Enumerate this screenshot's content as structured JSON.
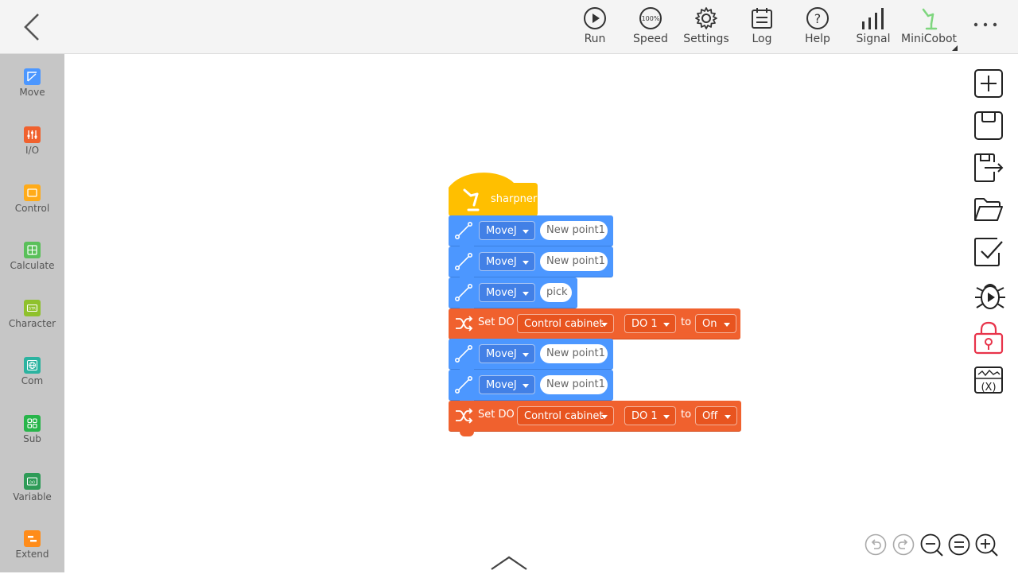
{
  "toolbar": {
    "run": "Run",
    "speed": "Speed",
    "speed_value": "100%",
    "settings": "Settings",
    "log": "Log",
    "help": "Help",
    "signal": "Signal",
    "robot": "MiniCobot"
  },
  "sidebar": {
    "items": [
      {
        "label": "Move",
        "color": "#4c97ff"
      },
      {
        "label": "I/O",
        "color": "#f0612e"
      },
      {
        "label": "Control",
        "color": "#ffab19"
      },
      {
        "label": "Calculate",
        "color": "#59c059"
      },
      {
        "label": "Character",
        "color": "#8fc12c"
      },
      {
        "label": "Com",
        "color": "#2bb3a0"
      },
      {
        "label": "Sub",
        "color": "#27b54a"
      },
      {
        "label": "Variable",
        "color": "#2e9b57"
      },
      {
        "label": "Extend",
        "color": "#ff8c1a"
      }
    ]
  },
  "program": {
    "hat": "sharpner",
    "blocks": [
      {
        "type": "move",
        "command": "MoveJ",
        "point": "New point1"
      },
      {
        "type": "move",
        "command": "MoveJ",
        "point": "New point1"
      },
      {
        "type": "move",
        "command": "MoveJ",
        "point": "pick"
      },
      {
        "type": "setdo",
        "label": "Set DO",
        "target": "Control cabinet",
        "port": "DO 1",
        "to": "to",
        "state": "On"
      },
      {
        "type": "move",
        "command": "MoveJ",
        "point": "New point1"
      },
      {
        "type": "move",
        "command": "MoveJ",
        "point": "New point1"
      },
      {
        "type": "setdo",
        "label": "Set DO",
        "target": "Control cabinet",
        "port": "DO 1",
        "to": "to",
        "state": "Off"
      }
    ]
  },
  "colors": {
    "move_block": "#4c97ff",
    "io_block": "#f0612e",
    "hat_block": "#ffbf00",
    "lock_icon": "#e8334a",
    "robot_icon": "#7ed67e"
  }
}
